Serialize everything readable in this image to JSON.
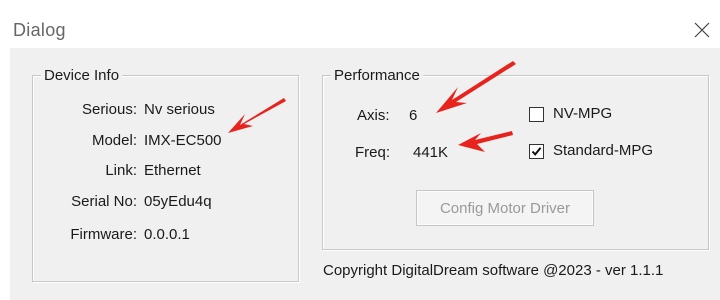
{
  "window": {
    "title": "Dialog",
    "close_icon": "close-icon"
  },
  "device_info": {
    "legend": "Device Info",
    "fields": [
      {
        "label": "Serious:",
        "value": "Nv serious"
      },
      {
        "label": "Model:",
        "value": "IMX-EC500"
      },
      {
        "label": "Link:",
        "value": "Ethernet"
      },
      {
        "label": "Serial No:",
        "value": "05yEdu4q"
      },
      {
        "label": "Firmware:",
        "value": "0.0.0.1"
      }
    ]
  },
  "performance": {
    "legend": "Performance",
    "axis_label": "Axis:",
    "axis_value": "6",
    "freq_label": "Freq:",
    "freq_value": "441K",
    "options": [
      {
        "label": "NV-MPG",
        "checked": false
      },
      {
        "label": "Standard-MPG",
        "checked": true
      }
    ],
    "config_button": "Config Motor Driver"
  },
  "footer": {
    "copyright": "Copyright DigitalDream software @2023 - ver 1.1.1"
  },
  "colors": {
    "annotation_arrow": "#e8231d",
    "dialog_background": "#f0f0f0",
    "disabled_text": "#9a9a9a"
  }
}
